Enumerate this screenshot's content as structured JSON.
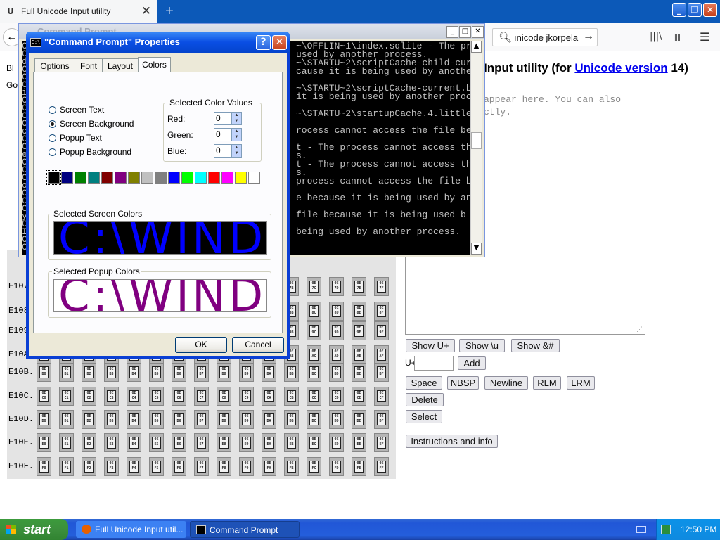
{
  "browser": {
    "tab_title": "Full Unicode Input utility",
    "tab_icon": "U",
    "url_text": "ınicode jkorpela"
  },
  "page": {
    "left_text_1": "Bl",
    "left_text_2": "Go",
    "heading_prefix": "Input utility (for ",
    "heading_link": "Unicode version",
    "heading_suffix": " 14)",
    "placeholder": "appear here. You can also\nctly.",
    "buttons_row1": [
      "Show U+",
      "Show \\u",
      "Show &#"
    ],
    "uplus_label": "U+",
    "add_label": "Add",
    "buttons_row2": [
      "Space",
      "NBSP",
      "Newline",
      "RLM",
      "LRM"
    ],
    "delete_label": "Delete",
    "select_label": "Select",
    "instructions_label": "Instructions and info",
    "grid_rows": [
      "E107",
      "E108",
      "E109",
      "E10A",
      "E10B.",
      "E10C.",
      "E10D.",
      "E10E.",
      "E10F."
    ]
  },
  "console": {
    "title": "Command Prompt",
    "lines": [
      "~\\OFFLIN~1\\index.sqlite - The pr",
      "used by another process.",
      "~\\STARTU~2\\scriptCache-child-curr",
      "cause it is being used by anothe",
      "",
      "~\\STARTU~2\\scriptCache-current.b",
      "it is being used by another proc",
      "",
      "~\\STARTU~2\\startupCache.4.little",
      "",
      "rocess cannot access the file be",
      "",
      "t - The process cannot access th",
      "s.",
      "t - The process cannot access th",
      "s.",
      "process cannot access the file b",
      "",
      "e because it is being used by an",
      "",
      "file because it is being used b",
      "",
      "being used by another process."
    ],
    "left_chars": [
      "C",
      "C",
      "d",
      "C",
      "C",
      "C",
      "i",
      "C",
      "C",
      "C",
      "C",
      "c",
      "C",
      "C",
      "e",
      "C",
      "C",
      "C",
      "o",
      "C",
      "C",
      "C",
      "y",
      "C",
      "I",
      "C",
      "C"
    ]
  },
  "dialog": {
    "title": "\"Command Prompt\" Properties",
    "help_label": "?",
    "close_label": "✕",
    "tabs": [
      "Options",
      "Font",
      "Layout",
      "Colors"
    ],
    "active_tab": "Colors",
    "radios": [
      "Screen Text",
      "Screen Background",
      "Popup Text",
      "Popup Background"
    ],
    "selected_radio": "Screen Background",
    "color_values_title": "Selected Color Values",
    "red_label": "Red:",
    "green_label": "Green:",
    "blue_label": "Blue:",
    "red_value": "0",
    "green_value": "0",
    "blue_value": "0",
    "palette": [
      "#000000",
      "#000080",
      "#008000",
      "#008080",
      "#800000",
      "#800080",
      "#808000",
      "#c0c0c0",
      "#808080",
      "#0000ff",
      "#00ff00",
      "#00ffff",
      "#ff0000",
      "#ff00ff",
      "#ffff00",
      "#ffffff"
    ],
    "screen_colors_label": "Selected Screen Colors",
    "popup_colors_label": "Selected Popup Colors",
    "preview_text": "C:\\WIND",
    "screen_text_color": "#0000ff",
    "screen_bg_color": "#000000",
    "popup_text_color": "#800080",
    "popup_bg_color": "#ffffff",
    "ok_label": "OK",
    "cancel_label": "Cancel"
  },
  "taskbar": {
    "start_label": "start",
    "tasks": [
      "Full Unicode Input util...",
      "Command Prompt"
    ],
    "clock": "12:50 PM"
  }
}
